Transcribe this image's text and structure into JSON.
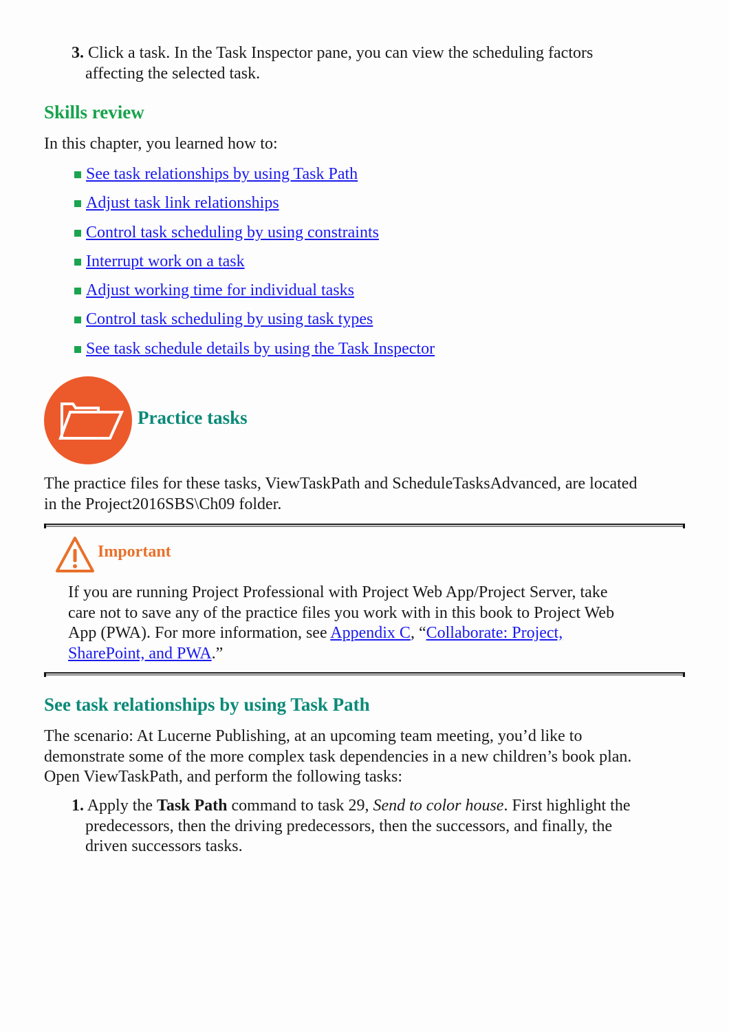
{
  "step3": {
    "number": "3.",
    "line1": "Click a task. In the Task Inspector pane, you can view the scheduling factors",
    "line2": "affecting the selected task."
  },
  "skills_review": {
    "heading": "Skills review",
    "intro": "In this chapter, you learned how to:",
    "items": [
      {
        "label": "See task relationships by using Task Path"
      },
      {
        "label": "Adjust task link relationships"
      },
      {
        "label": "Control task scheduling by using constraints"
      },
      {
        "label": "Interrupt work on a task"
      },
      {
        "label": "Adjust working time for individual tasks"
      },
      {
        "label": "Control task scheduling by using task types"
      },
      {
        "label": "See task schedule details by using the Task Inspector"
      }
    ]
  },
  "practice": {
    "icon": "folder-open-icon",
    "heading": "Practice tasks",
    "line1": "The practice files for these tasks, ViewTaskPath and ScheduleTasksAdvanced, are located",
    "line2": "in the Project2016SBS\\Ch09 folder."
  },
  "important": {
    "icon": "warning-icon",
    "title": "Important",
    "line1": "If you are running Project Professional with Project Web App/Project Server, take",
    "line2": "care not to save any of the practice files you work with in this book to Project Web",
    "line3_pre": "App (PWA). For more information, see ",
    "link1": "Appendix C",
    "mid": ", “",
    "link2a": "Collaborate: Project,",
    "link2b": "SharePoint, and PWA",
    "end": ".”"
  },
  "section": {
    "heading": "See task relationships by using Task Path",
    "para_line1": "The scenario: At Lucerne Publishing, at an upcoming team meeting, you’d like to",
    "para_line2": "demonstrate some of the more complex task dependencies in a new children’s book plan.",
    "para_line3": "Open ViewTaskPath, and perform the following tasks:",
    "step1": {
      "number": "1.",
      "pre": "Apply the ",
      "bold": "Task Path",
      "mid": " command to task 29, ",
      "italic": "Send to color house",
      "post": ". First highlight the",
      "line2": "predecessors, then the driving predecessors, then the successors, and finally, the",
      "line3": "driven successors tasks."
    }
  },
  "colors": {
    "heading_green": "#17a34d",
    "heading_teal": "#0a8a78",
    "link_blue": "#1a1aee",
    "practice_orange": "#ec5a2b",
    "important_orange": "#e8702a"
  }
}
